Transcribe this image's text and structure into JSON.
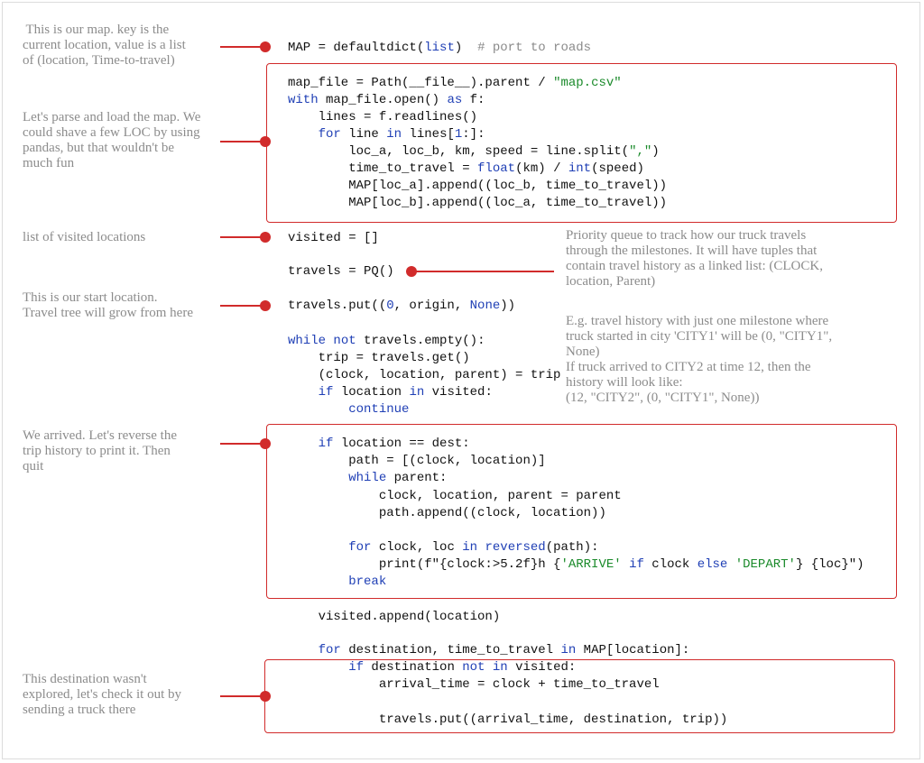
{
  "colors": {
    "accent": "#d12b2b",
    "keyword": "#1f3fb5",
    "string": "#1a8a2a",
    "comment": "#8a8a8a",
    "note": "#8c8c8c"
  },
  "code": [
    [
      [
        "MAP = defaultdict(",
        ""
      ],
      [
        "list",
        "kw"
      ],
      [
        ")  ",
        ""
      ],
      [
        "# port to roads",
        "cm"
      ]
    ],
    [
      [
        "map_file = Path(__file__).parent / ",
        ""
      ],
      [
        "\"map.csv\"",
        "str"
      ]
    ],
    [
      [
        "with",
        "kw"
      ],
      [
        " map_file.open() ",
        ""
      ],
      [
        "as",
        "kw"
      ],
      [
        " f:",
        ""
      ]
    ],
    [
      [
        "    lines = f.readlines()",
        ""
      ]
    ],
    [
      [
        "    ",
        ""
      ],
      [
        "for",
        "kw"
      ],
      [
        " line ",
        ""
      ],
      [
        "in",
        "kw"
      ],
      [
        " lines[",
        ""
      ],
      [
        "1",
        "kw"
      ],
      [
        ":]:",
        ""
      ]
    ],
    [
      [
        "        loc_a, loc_b, km, speed = line.split(",
        ""
      ],
      [
        "\",\"",
        "str"
      ],
      [
        ")",
        ""
      ]
    ],
    [
      [
        "        time_to_travel = ",
        ""
      ],
      [
        "float",
        "kw"
      ],
      [
        "(km) / ",
        ""
      ],
      [
        "int",
        "kw"
      ],
      [
        "(speed)",
        ""
      ]
    ],
    [
      [
        "        MAP[loc_a].append((loc_b, time_to_travel))",
        ""
      ]
    ],
    [
      [
        "        MAP[loc_b].append((loc_a, time_to_travel))",
        ""
      ]
    ],
    [
      [
        "visited = []",
        ""
      ]
    ],
    [
      [
        "travels = PQ()",
        ""
      ]
    ],
    [
      [
        "travels.put((",
        ""
      ],
      [
        "0",
        "kw"
      ],
      [
        ", origin, ",
        ""
      ],
      [
        "None",
        "kw"
      ],
      [
        "))",
        ""
      ]
    ],
    [
      [
        "while",
        "kw"
      ],
      [
        " ",
        ""
      ],
      [
        "not",
        "kw"
      ],
      [
        " travels.empty():",
        ""
      ]
    ],
    [
      [
        "    trip = travels.get()",
        ""
      ]
    ],
    [
      [
        "    (clock, location, parent) = trip",
        ""
      ]
    ],
    [
      [
        "    ",
        ""
      ],
      [
        "if",
        "kw"
      ],
      [
        " location ",
        ""
      ],
      [
        "in",
        "kw"
      ],
      [
        " visited:",
        ""
      ]
    ],
    [
      [
        "        ",
        ""
      ],
      [
        "continue",
        "kw"
      ]
    ],
    [
      [
        "    ",
        ""
      ],
      [
        "if",
        "kw"
      ],
      [
        " location == dest:",
        ""
      ]
    ],
    [
      [
        "        path = [(clock, location)]",
        ""
      ]
    ],
    [
      [
        "        ",
        ""
      ],
      [
        "while",
        "kw"
      ],
      [
        " parent:",
        ""
      ]
    ],
    [
      [
        "            clock, location, parent = parent",
        ""
      ]
    ],
    [
      [
        "            path.append((clock, location))",
        ""
      ]
    ],
    [
      [
        "        ",
        ""
      ],
      [
        "for",
        "kw"
      ],
      [
        " clock, loc ",
        ""
      ],
      [
        "in",
        "kw"
      ],
      [
        " ",
        ""
      ],
      [
        "reversed",
        "kw"
      ],
      [
        "(path):",
        ""
      ]
    ],
    [
      [
        "            print(f\"{clock:>5.2f}h {",
        ""
      ],
      [
        "'ARRIVE'",
        "str"
      ],
      [
        " ",
        ""
      ],
      [
        "if",
        "kw"
      ],
      [
        " clock ",
        ""
      ],
      [
        "else",
        "kw"
      ],
      [
        " ",
        ""
      ],
      [
        "'DEPART'",
        "str"
      ],
      [
        "} {loc}\")",
        ""
      ]
    ],
    [
      [
        "        ",
        ""
      ],
      [
        "break",
        "kw"
      ]
    ],
    [
      [
        "    visited.append(location)",
        ""
      ]
    ],
    [
      [
        "    ",
        ""
      ],
      [
        "for",
        "kw"
      ],
      [
        " destination, time_to_travel ",
        ""
      ],
      [
        "in",
        "kw"
      ],
      [
        " MAP[location]:",
        ""
      ]
    ],
    [
      [
        "        ",
        ""
      ],
      [
        "if",
        "kw"
      ],
      [
        " destination ",
        ""
      ],
      [
        "not",
        "kw"
      ],
      [
        " ",
        ""
      ],
      [
        "in",
        "kw"
      ],
      [
        " visited:",
        ""
      ]
    ],
    [
      [
        "            arrival_time = clock + time_to_travel",
        ""
      ]
    ],
    [
      [
        "            travels.put((arrival_time, destination, trip))",
        ""
      ]
    ]
  ],
  "notes": {
    "map": [
      " This is our map. key is the",
      "current location, value is a list",
      "of (location, Time-to-travel)"
    ],
    "parse": [
      "Let's parse and load the map. We",
      "could shave a few LOC by using",
      "pandas, but that wouldn't be",
      "much fun"
    ],
    "visited": [
      "list of visited locations"
    ],
    "pq": [
      "Priority queue to track how our truck travels",
      "through the milestones. It will have tuples that",
      "contain travel history as a linked list: (CLOCK,",
      "location, Parent)"
    ],
    "example": [
      "E.g. travel history with just one milestone where",
      "truck started in city 'CITY1' will be (0, \"CITY1\",",
      "None)",
      "If truck arrived to CITY2 at time 12, then the",
      "history will look like:",
      "(12, \"CITY2\", (0, \"CITY1\", None))"
    ],
    "start": [
      "This is our start location.",
      "Travel tree will grow from here"
    ],
    "arrived": [
      "We arrived. Let's reverse the",
      "trip history to print it. Then",
      "quit"
    ],
    "explore": [
      "This destination wasn't",
      "explored, let's check it out by",
      "sending a truck there"
    ]
  }
}
